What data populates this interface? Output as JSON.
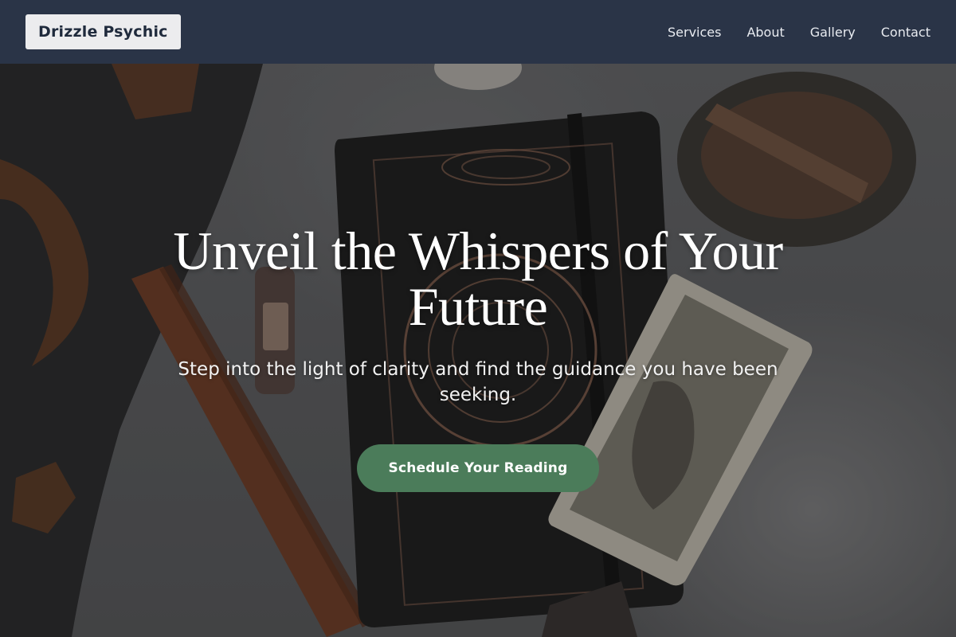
{
  "brand": {
    "name": "Drizzle Psychic"
  },
  "nav": {
    "items": [
      {
        "label": "Services"
      },
      {
        "label": "About"
      },
      {
        "label": "Gallery"
      },
      {
        "label": "Contact"
      }
    ]
  },
  "hero": {
    "title": "Unveil the Whispers of Your Future",
    "subtitle": "Step into the light of clarity and find the guidance you have been seeking.",
    "cta_label": "Schedule Your Reading"
  },
  "colors": {
    "navbar_bg": "#2a3447",
    "logo_bg": "#ececee",
    "cta_bg": "#4b7c5a",
    "hero_text": "#ffffff"
  }
}
